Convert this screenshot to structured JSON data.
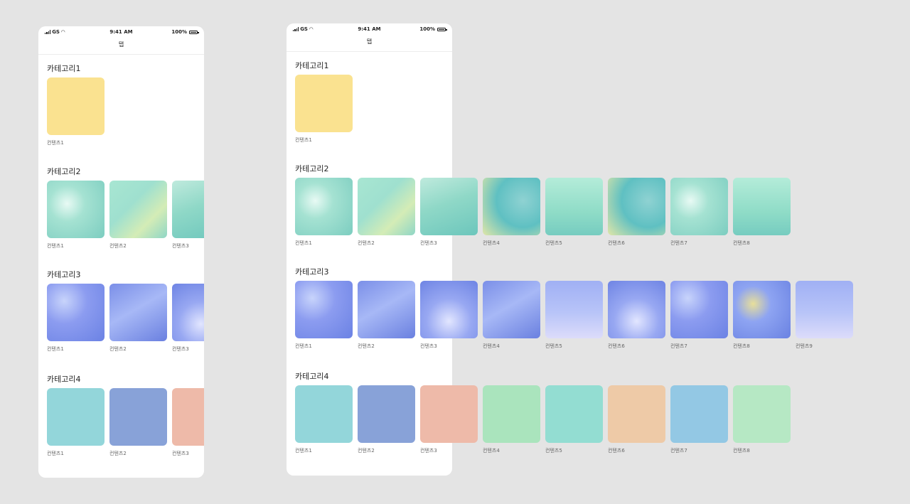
{
  "status": {
    "carrier": "GS",
    "time": "9:41 AM",
    "battery": "100%"
  },
  "nav_title": "탭",
  "left": {
    "categories": [
      {
        "title": "카테고리1",
        "items": [
          "컨텐츠1"
        ]
      },
      {
        "title": "카테고리2",
        "items": [
          "컨텐츠1",
          "컨텐츠2",
          "컨텐츠3"
        ]
      },
      {
        "title": "카테고리3",
        "items": [
          "컨텐츠1",
          "컨텐츠2",
          "컨텐츠3"
        ]
      },
      {
        "title": "카테고리4",
        "items": [
          "컨텐츠1",
          "컨텐츠2",
          "컨텐츠3"
        ]
      }
    ]
  },
  "right": {
    "categories": [
      {
        "title": "카테고리1",
        "items": [
          "컨텐츠1"
        ]
      },
      {
        "title": "카테고리2",
        "items": [
          "컨텐츠1",
          "컨텐츠2",
          "컨텐츠3",
          "컨텐츠4",
          "컨텐츠5",
          "컨텐츠6",
          "컨텐츠7",
          "컨텐츠8"
        ]
      },
      {
        "title": "카테고리3",
        "items": [
          "컨텐츠1",
          "컨텐츠2",
          "컨텐츠3",
          "컨텐츠4",
          "컨텐츠5",
          "컨텐츠6",
          "컨텐츠7",
          "컨텐츠8",
          "컨텐츠9"
        ]
      },
      {
        "title": "카테고리4",
        "items": [
          "컨텐츠1",
          "컨텐츠2",
          "컨텐츠3",
          "컨텐츠4",
          "컨텐츠5",
          "컨텐츠6",
          "컨텐츠7",
          "컨텐츠8"
        ]
      }
    ]
  },
  "colors": {
    "category1": "#fae290",
    "category4": [
      "#93d6da",
      "#88a2d8",
      "#eebaa9",
      "#aae4bd",
      "#93ddd2",
      "#eecaa7",
      "#93c8e4",
      "#b6e8c4"
    ]
  }
}
